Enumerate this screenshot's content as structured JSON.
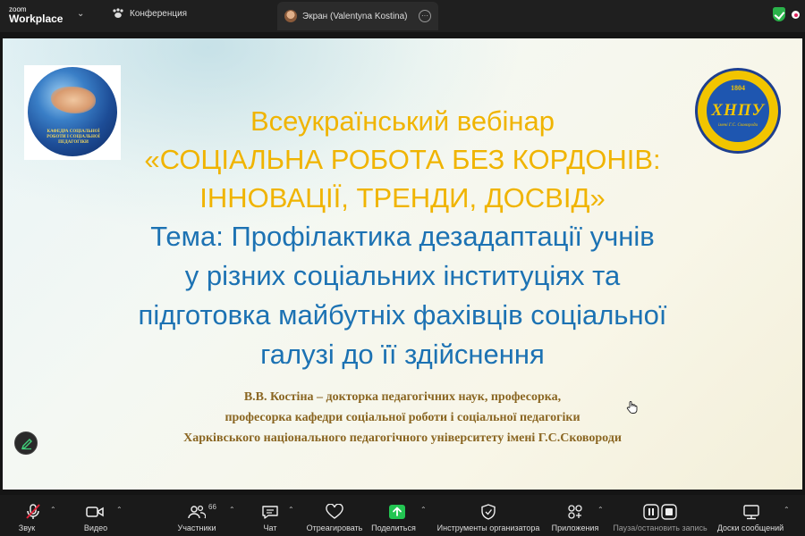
{
  "topbar": {
    "brand_small": "zoom",
    "brand_big": "Workplace",
    "tabs": [
      {
        "label": "Конференция"
      },
      {
        "label": "Экран (Valentyna Kostina)"
      }
    ]
  },
  "slide": {
    "globe_text": "КАФЕДРА СОЦІАЛЬНОЇ РОБОТИ І СОЦІАЛЬНОЇ ПЕДАГОГІКИ",
    "seal": {
      "year": "1804",
      "abbr": "ХНПУ",
      "name": "імені Г.С. Сковороди"
    },
    "title_lines": [
      "Всеукраїнський вебінар",
      "«СОЦІАЛЬНА РОБОТА БЕЗ КОРДОНІВ:",
      "ІННОВАЦІЇ, ТРЕНДИ, ДОСВІД»"
    ],
    "topic_lines": [
      "Тема: Профілактика дезадаптації учнів",
      "у різних соціальних інституціях та",
      "підготовка майбутніх фахівців соціальної",
      "галузі до її здійснення"
    ],
    "author_lines": [
      "В.В. Костіна – докторка педагогічних наук, професорка,",
      "професорка кафедри соціальної роботи і соціальної педагогіки",
      "Харківського національного педагогічного університету імені Г.С.Сковороди"
    ]
  },
  "toolbar": {
    "items": [
      {
        "label": "Звук",
        "icon": "mic-muted-icon"
      },
      {
        "label": "Видео",
        "icon": "video-icon"
      },
      {
        "label": "Участники",
        "icon": "participants-icon",
        "count": "66"
      },
      {
        "label": "Чат",
        "icon": "chat-icon"
      },
      {
        "label": "Отреагировать",
        "icon": "heart-icon"
      },
      {
        "label": "Поделиться",
        "icon": "share-icon"
      },
      {
        "label": "Инструменты организатора",
        "icon": "shield-icon"
      },
      {
        "label": "Приложения",
        "icon": "apps-icon"
      },
      {
        "label": "Пауза/остановить запись",
        "icon": "pause-record-icon"
      },
      {
        "label": "Доски сообщений",
        "icon": "whiteboard-icon"
      }
    ]
  },
  "colors": {
    "gold": "#f0b400",
    "blue": "#1c72b3",
    "brown": "#8a6622",
    "share_green": "#23c552"
  }
}
